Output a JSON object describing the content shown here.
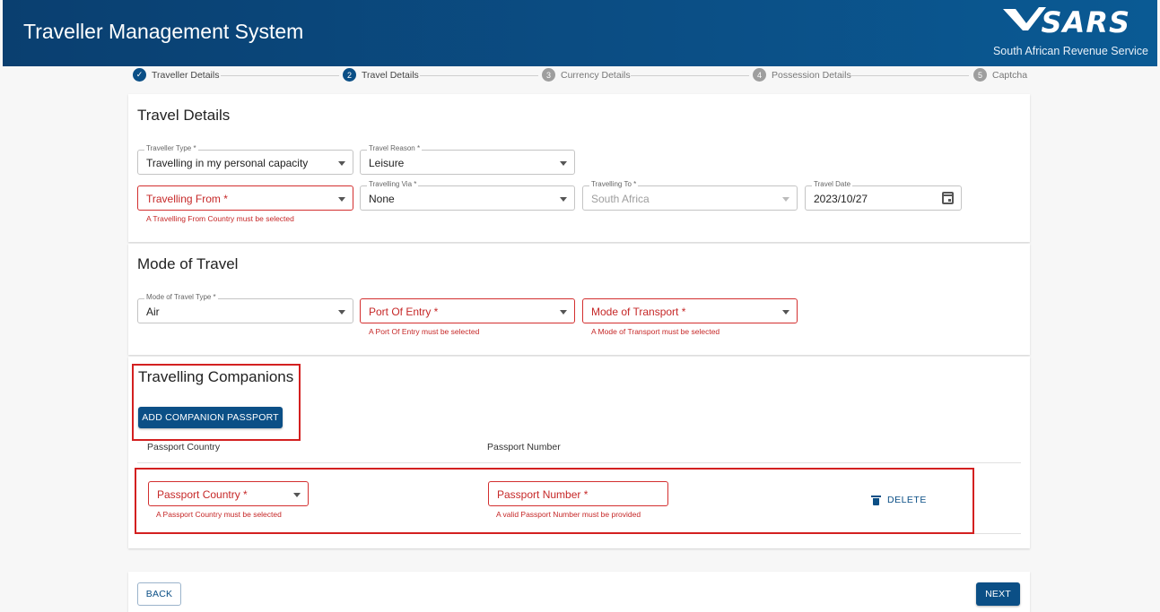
{
  "header": {
    "title": "Traveller Management System",
    "brand_logo": "SARS",
    "brand_subtitle": "South African Revenue Service"
  },
  "stepper": [
    {
      "num": "✓",
      "label": "Traveller Details",
      "state": "done"
    },
    {
      "num": "2",
      "label": "Travel Details",
      "state": "active"
    },
    {
      "num": "3",
      "label": "Currency Details",
      "state": "inactive"
    },
    {
      "num": "4",
      "label": "Possession Details",
      "state": "inactive"
    },
    {
      "num": "5",
      "label": "Captcha",
      "state": "inactive"
    }
  ],
  "travel_details": {
    "title": "Travel Details",
    "traveller_type": {
      "label": "Traveller Type *",
      "value": "Travelling in my personal capacity"
    },
    "travel_reason": {
      "label": "Travel Reason *",
      "value": "Leisure"
    },
    "travelling_from": {
      "placeholder": "Travelling From *",
      "error": "A Travelling From Country must be selected"
    },
    "travelling_via": {
      "label": "Travelling Via *",
      "value": "None"
    },
    "travelling_to": {
      "label": "Travelling To *",
      "value": "South Africa"
    },
    "travel_date": {
      "label": "Travel Date",
      "value": "2023/10/27"
    }
  },
  "mode_of_travel": {
    "title": "Mode of Travel",
    "type": {
      "label": "Mode of Travel Type *",
      "value": "Air"
    },
    "port_of_entry": {
      "placeholder": "Port Of Entry *",
      "error": "A Port Of Entry must be selected"
    },
    "mode_of_transport": {
      "placeholder": "Mode of Transport *",
      "error": "A Mode of Transport must be selected"
    }
  },
  "companions": {
    "title": "Travelling Companions",
    "add_button": "ADD COMPANION PASSPORT",
    "col_country": "Passport Country",
    "col_number": "Passport Number",
    "row": {
      "country_placeholder": "Passport Country *",
      "country_error": "A Passport Country must be selected",
      "number_placeholder": "Passport Number *",
      "number_error": "A valid Passport Number must be provided",
      "delete_label": "DELETE"
    }
  },
  "footer": {
    "back_label": "BACK",
    "next_label": "NEXT"
  },
  "colors": {
    "primary": "#0b4f86",
    "error": "#d32f2f",
    "highlight": "#d32020"
  }
}
